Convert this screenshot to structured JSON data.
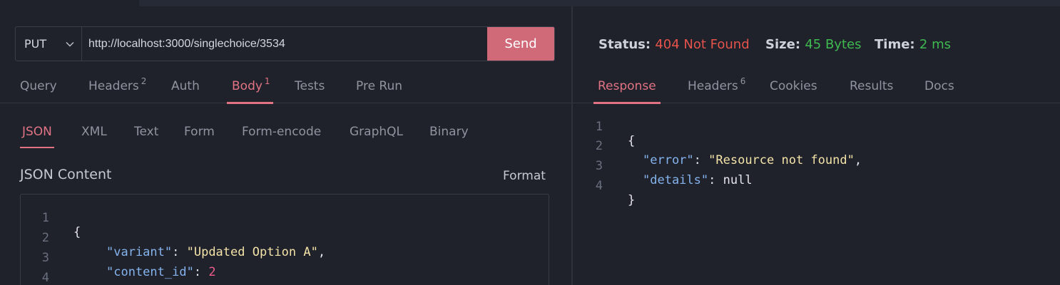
{
  "request": {
    "method": "PUT",
    "url": "http://localhost:3000/singlechoice/3534",
    "send_label": "Send"
  },
  "request_tabs": [
    {
      "label": "Query",
      "badge": ""
    },
    {
      "label": "Headers",
      "badge": "2"
    },
    {
      "label": "Auth",
      "badge": ""
    },
    {
      "label": "Body",
      "badge": "1",
      "active": true
    },
    {
      "label": "Tests",
      "badge": ""
    },
    {
      "label": "Pre Run",
      "badge": ""
    }
  ],
  "body_tabs": [
    {
      "label": "JSON",
      "active": true
    },
    {
      "label": "XML"
    },
    {
      "label": "Text"
    },
    {
      "label": "Form"
    },
    {
      "label": "Form-encode"
    },
    {
      "label": "GraphQL"
    },
    {
      "label": "Binary"
    }
  ],
  "json_section": {
    "title": "JSON Content",
    "format_label": "Format"
  },
  "request_body_lines": [
    {
      "n": "1"
    },
    {
      "n": "2",
      "key": "\"variant\"",
      "value": "\"Updated Option A\""
    },
    {
      "n": "3",
      "key": "\"content_id\"",
      "value": "2"
    },
    {
      "n": "4"
    }
  ],
  "response_status": {
    "status_label": "Status:",
    "status_value": "404 Not Found",
    "size_label": "Size:",
    "size_value": "45 Bytes",
    "time_label": "Time:",
    "time_value": "2 ms"
  },
  "response_tabs": [
    {
      "label": "Response",
      "badge": "",
      "active": true
    },
    {
      "label": "Headers",
      "badge": "6"
    },
    {
      "label": "Cookies",
      "badge": ""
    },
    {
      "label": "Results",
      "badge": ""
    },
    {
      "label": "Docs",
      "badge": ""
    }
  ],
  "response_body_lines": [
    {
      "n": "1"
    },
    {
      "n": "2",
      "key": "\"error\"",
      "value": "\"Resource not found\""
    },
    {
      "n": "3",
      "key": "\"details\"",
      "value": "null"
    },
    {
      "n": "4"
    }
  ],
  "colors": {
    "accent": "#e27384",
    "send_button": "#d06a79",
    "error_status": "#e5534b",
    "success_value": "#3fb950"
  }
}
